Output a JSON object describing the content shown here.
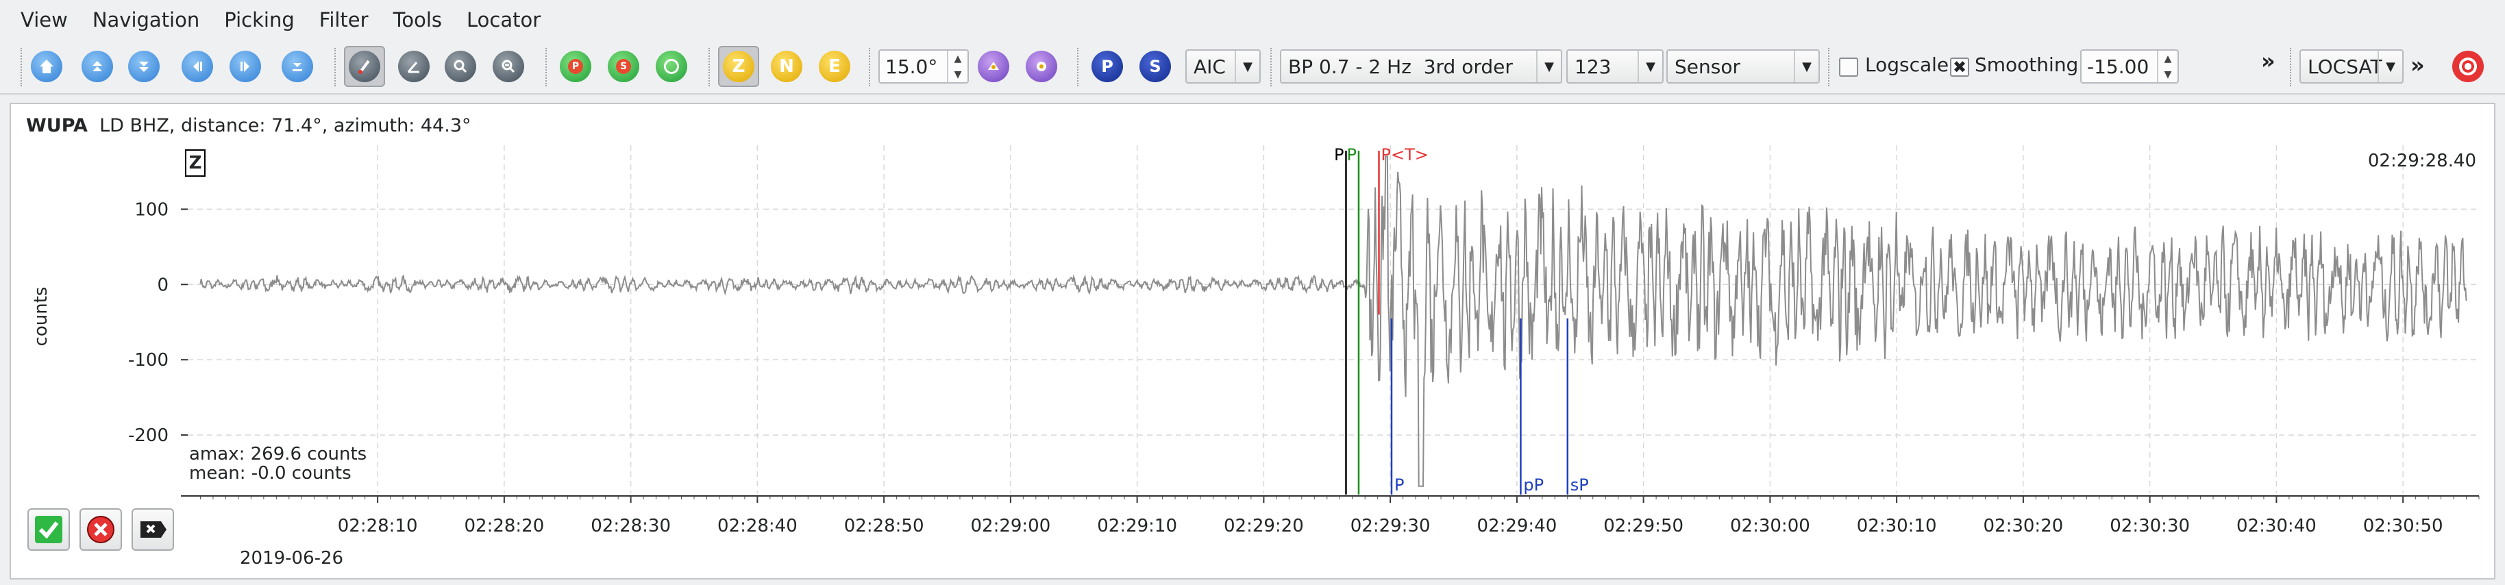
{
  "menu": [
    "View",
    "Navigation",
    "Picking",
    "Filter",
    "Tools",
    "Locator"
  ],
  "toolbar": {
    "nav_icons": [
      "home-icon",
      "scroll-up-icon",
      "scroll-down-icon",
      "scroll-left-icon",
      "scroll-right-icon",
      "expand-icon"
    ],
    "tool_icons": [
      "pick-tool-icon",
      "measure-angle-icon",
      "zoom-icon",
      "zoom-out-icon"
    ],
    "pick_icons": [
      "pick-p-icon",
      "pick-s-icon",
      "pick-refresh-icon"
    ],
    "components": {
      "z": "Z",
      "n": "N",
      "e": "E"
    },
    "deg_value": "15.0°",
    "phase_p": "P",
    "phase_s": "S",
    "algorithm": "AIC",
    "filter": "BP 0.7 - 2 Hz  3rd order",
    "trace_count": "123",
    "sort": "Sensor",
    "logscale_label": "Logscale",
    "logscale_checked": false,
    "smoothing_label": "Smoothing",
    "smoothing_checked": true,
    "smoothing_value": "-15.00",
    "more": "»",
    "locator": "LOCSAT",
    "more2": "»",
    "colors": {
      "accent": "#3d8fe0",
      "yellow": "#f1c40f",
      "blue_pick": "#1f3fbf",
      "red_pick": "#e63333"
    }
  },
  "trace": {
    "station": "WUPA",
    "details": "LD  BHZ, distance: 71.4°, azimuth: 44.3°",
    "component": "Z",
    "end_time": "02:29:28.40",
    "ylabel": "counts",
    "amax": "amax: 269.6 counts",
    "mean": "mean: -0.0 counts",
    "date": "2019-06-26"
  },
  "chart_data": {
    "type": "line",
    "ylabel": "counts",
    "yticks": [
      100,
      0,
      -100,
      -200
    ],
    "ylim": [
      -270,
      185
    ],
    "xticks": [
      "02:28:10",
      "02:28:20",
      "02:28:30",
      "02:28:40",
      "02:28:50",
      "02:29:00",
      "02:29:10",
      "02:29:20",
      "02:29:30",
      "02:29:40",
      "02:29:50",
      "02:30:00",
      "02:30:10",
      "02:30:20",
      "02:30:30",
      "02:30:40",
      "02:30:50"
    ],
    "xlim_seconds_after_022800": [
      -5,
      176
    ],
    "picks": [
      {
        "label": "P",
        "t": 86.5,
        "color": "#000000",
        "where": "top"
      },
      {
        "label": "P",
        "t": 87.5,
        "color": "#1a8f1a",
        "where": "top"
      },
      {
        "label": "P<T>",
        "t": 89.1,
        "color": "#e63333",
        "where": "top"
      }
    ],
    "theoretical": [
      {
        "label": "P",
        "t": 90.1,
        "color": "#1f3fbf"
      },
      {
        "label": "pP",
        "t": 100.3,
        "color": "#1f3fbf"
      },
      {
        "label": "sP",
        "t": 104.0,
        "color": "#1f3fbf"
      }
    ],
    "grid": true
  }
}
